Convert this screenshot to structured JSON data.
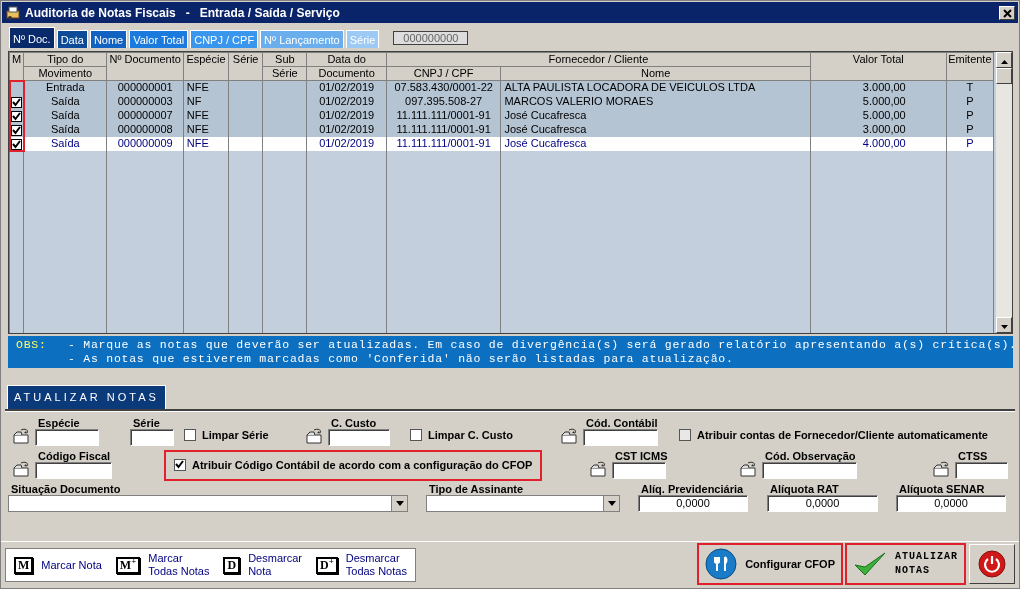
{
  "window": {
    "title": "Auditoria de Notas Fiscais   -   Entrada / Saída / Serviço"
  },
  "sort_tabs": [
    {
      "label": "Nº Doc.",
      "selected": true
    },
    {
      "label": "Data",
      "selected": false
    },
    {
      "label": "Nome",
      "selected": false
    },
    {
      "label": "Valor Total",
      "selected": false
    },
    {
      "label": "CNPJ / CPF",
      "selected": false
    },
    {
      "label": "Nº Lançamento",
      "selected": false
    },
    {
      "label": "Série",
      "selected": false
    }
  ],
  "search": {
    "value": "000000000"
  },
  "table": {
    "check_column": {
      "label": "M",
      "highlighted": true
    },
    "columns": [
      {
        "label": "Tipo do",
        "sublabel": "Movimento"
      },
      {
        "label": "Nº Documento"
      },
      {
        "label": "Espécie"
      },
      {
        "label": "Série"
      },
      {
        "label": "Sub",
        "sublabel": "Série"
      },
      {
        "label": "Data do",
        "sublabel": "Documento"
      },
      {
        "group": "Fornecedor / Cliente",
        "colspan": 2,
        "columns": [
          {
            "label": "CNPJ / CPF"
          },
          {
            "label": "Nome"
          }
        ]
      },
      {
        "label": "Valor Total"
      },
      {
        "label": "Emitente"
      }
    ],
    "rows": [
      {
        "checked": false,
        "selected": false,
        "cells": [
          "Entrada",
          "000000001",
          "NFE",
          "",
          "",
          "01/02/2019",
          "07.583.430/0001-22",
          "ALTA PAULISTA LOCADORA DE VEICULOS LTDA",
          "3.000,00",
          "T"
        ]
      },
      {
        "checked": true,
        "selected": false,
        "cells": [
          "Saída",
          "000000003",
          "NF",
          "",
          "",
          "01/02/2019",
          "097.395.508-27",
          "MARCOS VALERIO MORAES",
          "5.000,00",
          "P"
        ]
      },
      {
        "checked": true,
        "selected": false,
        "cells": [
          "Saída",
          "000000007",
          "NFE",
          "",
          "",
          "01/02/2019",
          "11.111.111/0001-91",
          "José Cucafresca",
          "5.000,00",
          "P"
        ]
      },
      {
        "checked": true,
        "selected": false,
        "cells": [
          "Saída",
          "000000008",
          "NFE",
          "",
          "",
          "01/02/2019",
          "11.111.111/0001-91",
          "José Cucafresca",
          "3.000,00",
          "P"
        ]
      },
      {
        "checked": true,
        "selected": true,
        "cells": [
          "Saída",
          "000000009",
          "NFE",
          "",
          "",
          "01/02/2019",
          "11.111.111/0001-91",
          "José Cucafresca",
          "4.000,00",
          "P"
        ]
      }
    ]
  },
  "obs": {
    "label": "OBS:",
    "lines": [
      "- Marque as notas que deverão ser atualizadas. Em caso de divergência(s) será gerado relatório apresentando a(s) crítica(s).",
      "- As notas que estiverem marcadas como 'Conferida' não serão listadas para atualização."
    ]
  },
  "form": {
    "tab": "ATUALIZAR NOTAS",
    "lines": [
      {
        "items": [
          {
            "kind": "field",
            "label": "Espécie",
            "lookup": true
          },
          {
            "kind": "field",
            "label": "Série",
            "lookup": false
          },
          {
            "kind": "checkbox",
            "label": "Limpar Série",
            "checked": false,
            "highlighted": false
          },
          {
            "kind": "field",
            "label": "C. Custo",
            "lookup": true
          },
          {
            "kind": "checkbox",
            "label": "Limpar C. Custo",
            "checked": false,
            "highlighted": false
          },
          {
            "kind": "field",
            "label": "Cód. Contábil",
            "lookup": true
          },
          {
            "kind": "checkbox",
            "label": "Atribuir contas de Fornecedor/Cliente automaticamente",
            "checked": false,
            "highlighted": false
          }
        ]
      },
      {
        "items": [
          {
            "kind": "field",
            "label": "Código Fiscal",
            "lookup": true
          },
          {
            "kind": "checkbox",
            "label": "Atribuir Código Contábil de acordo com a configuração do CFOP",
            "checked": true,
            "highlighted": true
          },
          {
            "kind": "field",
            "label": "CST ICMS",
            "lookup": true
          },
          {
            "kind": "field",
            "label": "Cód. Observação",
            "lookup": true
          },
          {
            "kind": "field",
            "label": "CTSS",
            "lookup": true
          }
        ]
      },
      {
        "items": [
          {
            "kind": "select",
            "label": "Situação Documento"
          },
          {
            "kind": "select",
            "label": "Tipo de Assinante"
          },
          {
            "kind": "number",
            "label": "Alíq. Previdenciária",
            "value": "0,0000"
          },
          {
            "kind": "number",
            "label": "Alíquota RAT",
            "value": "0,0000"
          },
          {
            "kind": "number",
            "label": "Alíquota SENAR",
            "value": "0,0000"
          }
        ]
      }
    ]
  },
  "legend": [
    {
      "key": "M",
      "lines": [
        "Marcar Nota"
      ]
    },
    {
      "key": "M$^{+}$",
      "lines": [
        "Marcar",
        "Todas Notas"
      ]
    },
    {
      "key": "D",
      "lines": [
        "Desmarcar",
        "Nota"
      ]
    },
    {
      "key": "D$^{+}$",
      "lines": [
        "Desmarcar",
        "Todas Notas"
      ]
    }
  ],
  "actions": [
    {
      "kind": "cfop",
      "lines": [
        "Configurar CFOP"
      ],
      "highlighted": true
    },
    {
      "kind": "update",
      "lines": [
        "ATUALIZAR",
        "NOTAS"
      ],
      "highlighted": true
    },
    {
      "kind": "power",
      "highlighted": false
    }
  ]
}
